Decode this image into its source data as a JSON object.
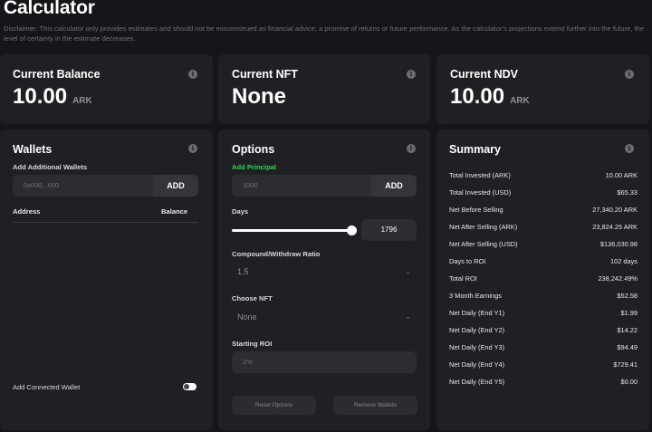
{
  "page": {
    "title": "Calculator",
    "disclaimer": "Disclaimer: This calculator only provides estimates and should not be misconstrued as financial advice, a promise of returns or future performance. As the calculator's projections extend further into the future, the level of certainty in the estimate decreases."
  },
  "balance": {
    "title": "Current Balance",
    "value": "10.00",
    "unit": "ARK"
  },
  "nft": {
    "title": "Current NFT",
    "value": "None"
  },
  "ndv": {
    "title": "Current NDV",
    "value": "10.00",
    "unit": "ARK"
  },
  "wallets": {
    "title": "Wallets",
    "add_label": "Add Additional Wallets",
    "input_placeholder": "0x000...000",
    "add_button": "ADD",
    "col_address": "Address",
    "col_balance": "Balance",
    "connected_label": "Add Connected Wallet",
    "connected_toggle_on": true
  },
  "options": {
    "title": "Options",
    "principal_label": "Add Principal",
    "principal_placeholder": "1000",
    "add_button": "ADD",
    "days_label": "Days",
    "days_value": "1796",
    "days_slider_fraction": 1.0,
    "ratio_label": "Compound/Withdraw Ratio",
    "ratio_value": "1.5",
    "nft_label": "Choose NFT",
    "nft_value": "None",
    "roi_label": "Starting ROI",
    "roi_placeholder": "2%",
    "reset_button": "Reset Options",
    "remove_button": "Remove Wallets"
  },
  "summary": {
    "title": "Summary",
    "rows": [
      {
        "label": "Total Invested (ARK)",
        "value": "10.00 ARK"
      },
      {
        "label": "Total Invested (USD)",
        "value": "$65.33"
      },
      {
        "label": "Net Before Selling",
        "value": "27,340.20 ARK"
      },
      {
        "label": "Net After Selling (ARK)",
        "value": "23,824.25 ARK"
      },
      {
        "label": "Net After Selling (USD)",
        "value": "$136,030.98"
      },
      {
        "label": "Days to ROI",
        "value": "102 days"
      },
      {
        "label": "Total ROI",
        "value": "238,242.49%"
      },
      {
        "label": "3 Month Earnings",
        "value": "$52.58"
      },
      {
        "label": "Net Daily (End Y1)",
        "value": "$1.99"
      },
      {
        "label": "Net Daily (End Y2)",
        "value": "$14.22"
      },
      {
        "label": "Net Daily (End Y3)",
        "value": "$94.49"
      },
      {
        "label": "Net Daily (End Y4)",
        "value": "$729.41"
      },
      {
        "label": "Net Daily (End Y5)",
        "value": "$0.00"
      }
    ]
  },
  "icons": {
    "info": "info-icon",
    "dropdown": "chevron-down-icon"
  },
  "colors": {
    "background": "#151619",
    "card": "#1f2024",
    "accent_green": "#38d163"
  }
}
